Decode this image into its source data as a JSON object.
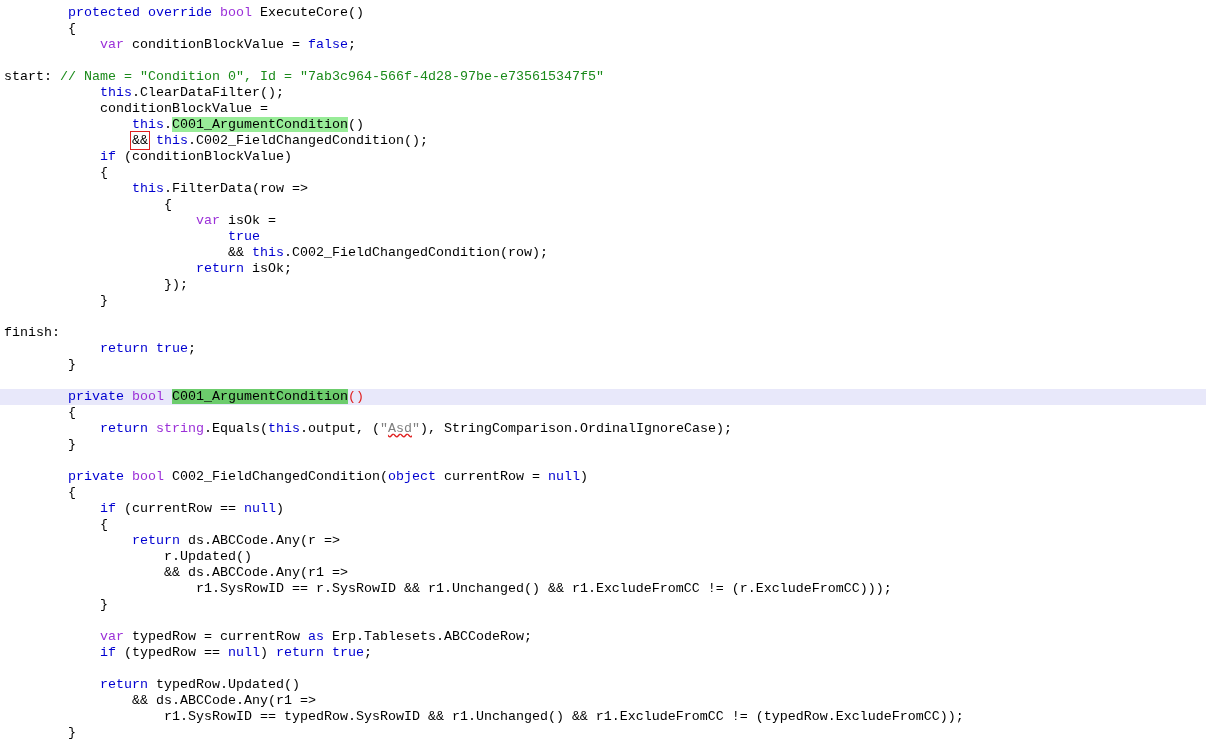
{
  "editor": {
    "lines": [
      {
        "current": false,
        "tokens": [
          {
            "t": "        protected",
            "kind": "keyword"
          },
          {
            "t": " override",
            "kind": "keyword"
          },
          {
            "t": " bool",
            "kind": "type"
          },
          {
            "t": " ExecuteCore()"
          }
        ]
      },
      {
        "current": false,
        "tokens": [
          {
            "t": "        {"
          }
        ]
      },
      {
        "current": false,
        "tokens": [
          {
            "t": "            var",
            "kind": "type"
          },
          {
            "t": " conditionBlockValue = "
          },
          {
            "t": "false",
            "kind": "keyword"
          },
          {
            "t": ";"
          }
        ]
      },
      {
        "current": false
      },
      {
        "current": false,
        "tokens": [
          {
            "t": "start: "
          },
          {
            "t": "// Name = \"Condition 0\", Id = \"7ab3c964-566f-4d28-97be-e735615347f5\"",
            "kind": "comment"
          }
        ]
      },
      {
        "current": false,
        "tokens": [
          {
            "t": "            this",
            "kind": "keyword"
          },
          {
            "t": ".ClearDataFilter();"
          }
        ]
      },
      {
        "current": false,
        "tokens": [
          {
            "t": "            conditionBlockValue ="
          }
        ]
      },
      {
        "current": false,
        "tokens": [
          {
            "t": "                this",
            "kind": "keyword"
          },
          {
            "t": "."
          },
          {
            "t": "C001_ArgumentCondition",
            "kind": "highlight"
          },
          {
            "t": "()"
          }
        ]
      },
      {
        "current": false,
        "tokens": [
          {
            "t": "                &&",
            "kind": "boxed"
          },
          {
            "t": " this",
            "kind": "keyword"
          },
          {
            "t": ".C002_FieldChangedCondition();"
          }
        ]
      },
      {
        "current": false,
        "tokens": [
          {
            "t": "            if",
            "kind": "keyword"
          },
          {
            "t": " (conditionBlockValue)"
          }
        ]
      },
      {
        "current": false,
        "tokens": [
          {
            "t": "            {"
          }
        ]
      },
      {
        "current": false,
        "tokens": [
          {
            "t": "                this",
            "kind": "keyword"
          },
          {
            "t": ".FilterData(row =>"
          }
        ]
      },
      {
        "current": false,
        "tokens": [
          {
            "t": "                    {"
          }
        ]
      },
      {
        "current": false,
        "tokens": [
          {
            "t": "                        var",
            "kind": "type"
          },
          {
            "t": " isOk ="
          }
        ]
      },
      {
        "current": false,
        "tokens": [
          {
            "t": "                            true",
            "kind": "keyword"
          }
        ]
      },
      {
        "current": false,
        "tokens": [
          {
            "t": "                            && "
          },
          {
            "t": "this",
            "kind": "keyword"
          },
          {
            "t": ".C002_FieldChangedCondition(row);"
          }
        ]
      },
      {
        "current": false,
        "tokens": [
          {
            "t": "                        return",
            "kind": "keyword"
          },
          {
            "t": " isOk;"
          }
        ]
      },
      {
        "current": false,
        "tokens": [
          {
            "t": "                    });"
          }
        ]
      },
      {
        "current": false,
        "tokens": [
          {
            "t": "            }"
          }
        ]
      },
      {
        "current": false
      },
      {
        "current": false,
        "tokens": [
          {
            "t": "finish:"
          }
        ]
      },
      {
        "current": false,
        "tokens": [
          {
            "t": "            return",
            "kind": "keyword"
          },
          {
            "t": " true",
            "kind": "keyword"
          },
          {
            "t": ";"
          }
        ]
      },
      {
        "current": false,
        "tokens": [
          {
            "t": "        }"
          }
        ]
      },
      {
        "current": false
      },
      {
        "current": true,
        "tokens": [
          {
            "t": "        private",
            "kind": "keyword"
          },
          {
            "t": " bool ",
            "kind": "type"
          },
          {
            "t": "C001_ArgumentCondition",
            "kind": "selection"
          },
          {
            "t": "()",
            "kind": "error"
          }
        ]
      },
      {
        "current": false,
        "tokens": [
          {
            "t": "        {"
          }
        ]
      },
      {
        "current": false,
        "tokens": [
          {
            "t": "            return",
            "kind": "keyword"
          },
          {
            "t": " string",
            "kind": "type"
          },
          {
            "t": ".Equals("
          },
          {
            "t": "this",
            "kind": "keyword"
          },
          {
            "t": ".output, ("
          },
          {
            "t": "\"",
            "kind": "string"
          },
          {
            "t": "Asd",
            "kind": "misspelled"
          },
          {
            "t": "\"",
            "kind": "string"
          },
          {
            "t": "), StringComparison.OrdinalIgnoreCase);"
          }
        ]
      },
      {
        "current": false,
        "tokens": [
          {
            "t": "        }"
          }
        ]
      },
      {
        "current": false
      },
      {
        "current": false,
        "tokens": [
          {
            "t": "        private",
            "kind": "keyword"
          },
          {
            "t": " bool",
            "kind": "type"
          },
          {
            "t": " C002_FieldChangedCondition("
          },
          {
            "t": "object",
            "kind": "keyword"
          },
          {
            "t": " currentRow = "
          },
          {
            "t": "null",
            "kind": "keyword"
          },
          {
            "t": ")"
          }
        ]
      },
      {
        "current": false,
        "tokens": [
          {
            "t": "        {"
          }
        ]
      },
      {
        "current": false,
        "tokens": [
          {
            "t": "            if",
            "kind": "keyword"
          },
          {
            "t": " (currentRow == "
          },
          {
            "t": "null",
            "kind": "keyword"
          },
          {
            "t": ")"
          }
        ]
      },
      {
        "current": false,
        "tokens": [
          {
            "t": "            {"
          }
        ]
      },
      {
        "current": false,
        "tokens": [
          {
            "t": "                return",
            "kind": "keyword"
          },
          {
            "t": " ds.ABCCode.Any(r =>"
          }
        ]
      },
      {
        "current": false,
        "tokens": [
          {
            "t": "                    r.Updated()"
          }
        ]
      },
      {
        "current": false,
        "tokens": [
          {
            "t": "                    && ds.ABCCode.Any(r1 =>"
          }
        ]
      },
      {
        "current": false,
        "tokens": [
          {
            "t": "                        r1.SysRowID == r.SysRowID && r1.Unchanged() && r1.ExcludeFromCC != (r.ExcludeFromCC)));"
          }
        ]
      },
      {
        "current": false,
        "tokens": [
          {
            "t": "            }"
          }
        ]
      },
      {
        "current": false
      },
      {
        "current": false,
        "tokens": [
          {
            "t": "            var",
            "kind": "type"
          },
          {
            "t": " typedRow = currentRow "
          },
          {
            "t": "as",
            "kind": "keyword"
          },
          {
            "t": " Erp.Tablesets.ABCCodeRow;"
          }
        ]
      },
      {
        "current": false,
        "tokens": [
          {
            "t": "            if",
            "kind": "keyword"
          },
          {
            "t": " (typedRow == "
          },
          {
            "t": "null",
            "kind": "keyword"
          },
          {
            "t": ") "
          },
          {
            "t": "return",
            "kind": "keyword"
          },
          {
            "t": " true",
            "kind": "keyword"
          },
          {
            "t": ";"
          }
        ]
      },
      {
        "current": false
      },
      {
        "current": false,
        "tokens": [
          {
            "t": "            return",
            "kind": "keyword"
          },
          {
            "t": " typedRow.Updated()"
          }
        ]
      },
      {
        "current": false,
        "tokens": [
          {
            "t": "                && ds.ABCCode.Any(r1 =>"
          }
        ]
      },
      {
        "current": false,
        "tokens": [
          {
            "t": "                    r1.SysRowID == typedRow.SysRowID && r1.Unchanged() && r1.ExcludeFromCC != (typedRow.ExcludeFromCC));"
          }
        ]
      },
      {
        "current": false,
        "tokens": [
          {
            "t": "        }"
          }
        ]
      }
    ]
  }
}
